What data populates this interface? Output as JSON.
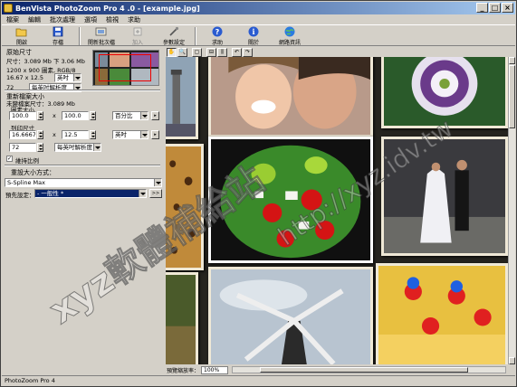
{
  "window": {
    "title": "BenVista PhotoZoom Pro 4 .0 - [example.jpg]",
    "controls": [
      "_",
      "□",
      "×"
    ]
  },
  "menu": [
    "檔案",
    "編輯",
    "批次處理",
    "選項",
    "檢視",
    "求助"
  ],
  "toolbar": {
    "items": [
      {
        "label": "開啟",
        "icon": "open-folder-icon",
        "disabled": false
      },
      {
        "label": "存檔",
        "icon": "save-disk-icon",
        "disabled": false
      },
      {
        "label": "開新批次檔",
        "icon": "new-batch-icon",
        "disabled": false
      },
      {
        "label": "加入",
        "icon": "add-icon",
        "disabled": true
      },
      {
        "label": "參數設定",
        "icon": "settings-icon",
        "disabled": false
      },
      {
        "label": "求助",
        "icon": "help-icon",
        "disabled": false
      },
      {
        "label": "關於",
        "icon": "info-icon",
        "disabled": false
      },
      {
        "label": "網路資訊",
        "icon": "globe-icon",
        "disabled": false
      }
    ]
  },
  "original": {
    "group_label": "原始尺寸",
    "size_line": "尺寸：3.089 Mb 下 3.06 Mb",
    "pixels_line": "1200 x 900 圖素, RGB/8",
    "dim_value": "16.67 x 12.5",
    "dim_unit": "英吋",
    "res_value": "72",
    "res_unit": "每英吋解析度"
  },
  "new_size": {
    "group_label": "重新檔案大小",
    "size_line": "未變檔案尺寸：3.089 Mb",
    "pixel_label": "圖素大小",
    "pixel_w": "100.0",
    "pixel_h": "100.0",
    "pixel_unit": "百分比",
    "print_label": "列印尺寸",
    "print_w": "16.6667",
    "print_h": "12.5",
    "print_unit": "英吋",
    "res_value": "72",
    "res_unit": "每英吋解析度",
    "x_sign": "x",
    "keep_ratio_label": "維持比例",
    "keep_ratio_checked": true
  },
  "resize_method": {
    "label": "重設大小方式：",
    "value": "S-Spline Max",
    "preset_label": "預先設定：",
    "preset_value": "- 一般性 *",
    "more_btn": ">>"
  },
  "viewer": {
    "tool_buttons": [
      "hand-icon",
      "zoom-icon",
      "split-icon",
      "horizontal-split-icon",
      "vertical-split-icon",
      "rotate-left-icon",
      "rotate-right-icon"
    ]
  },
  "zoom": {
    "label": "預覽縮放率：",
    "value": "100%"
  },
  "status": {
    "text": "PhotoZoom Pro 4"
  },
  "watermark": {
    "text_1": "xyz軟體補給站",
    "text_2": "http://xyz.idv.tw"
  }
}
